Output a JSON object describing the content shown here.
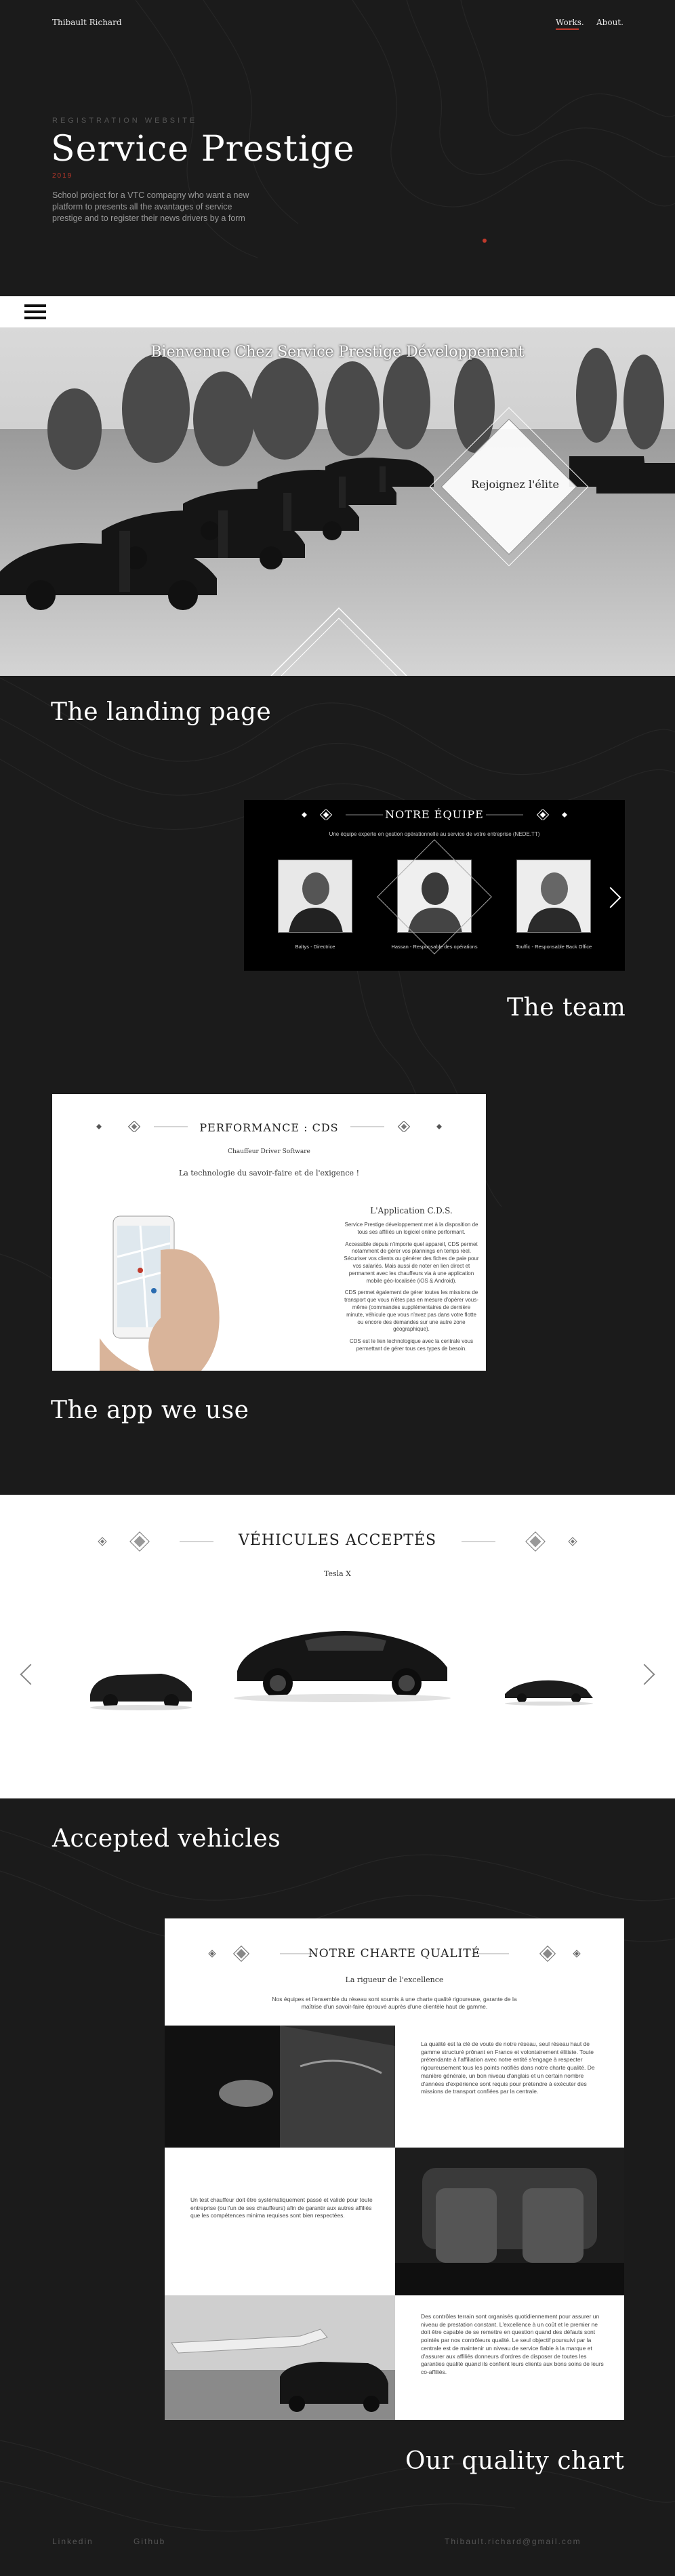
{
  "header": {
    "site_name": "Thibault Richard",
    "nav": {
      "works": "Works.",
      "about": "About."
    }
  },
  "hero": {
    "kicker": "REGISTRATION WEBSITE",
    "title": "Service Prestige",
    "tag": "2019",
    "description": "School project for a VTC compagny who want a new platform to presents all the avantages of service prestige and to register their news drivers by a form"
  },
  "landing": {
    "heading": "Bienvenue Chez Service Prestige Développement",
    "join_label": "Rejoignez l'élite",
    "caption": "The landing page"
  },
  "team": {
    "title": "NOTRE ÉQUIPE",
    "subtitle": "Une équipe experte en gestion opérationnelle au service de votre entreprise (NEDE.TT)",
    "members": [
      {
        "name": "Baltys - Directrice"
      },
      {
        "name": "Hassan - Responsable des opérations"
      },
      {
        "name": "Touffic - Responsable Back Office"
      }
    ],
    "caption": "The team"
  },
  "app": {
    "title": "PERFORMANCE : CDS",
    "subtitle1": "Chauffeur Driver Software",
    "subtitle2": "La technologie du savoir-faire et de l'exigence !",
    "column_title": "L'Application C.D.S.",
    "paragraphs": [
      "Service Prestige développement met à la disposition de tous ses affiliés un logiciel online performant.",
      "Accessible depuis n'importe quel appareil, CDS permet notamment de gérer vos plannings en temps réel. Sécuriser vos clients ou générer des fiches de paie pour vos salariés. Mais aussi de noter en lien direct et permanent avec les chauffeurs via à une application mobile géo-localisée (iOS & Android).",
      "CDS permet également de gérer toutes les missions de transport que vous n'êtes pas en mesure d'opérer vous-même (commandes supplémentaires de dernière minute, véhicule que vous n'avez pas dans votre flotte ou encore des demandes sur une autre zone géographique).",
      "CDS est le lien technologique avec la centrale vous permettant de gérer tous ces types de besoin."
    ],
    "caption": "The app we use"
  },
  "vehicles": {
    "title": "VÉHICULES ACCEPTÉS",
    "current": "Tesla X",
    "caption": "Accepted vehicles"
  },
  "quality": {
    "title": "NOTRE CHARTE QUALITÉ",
    "subtitle": "La rigueur de l'excellence",
    "intro": "Nos équipes et l'ensemble du réseau sont soumis à une charte qualité rigoureuse, garante de la maîtrise d'un savoir-faire éprouvé auprès d'une clientèle haut de gamme.",
    "block1": "La qualité est la clé de voute de notre réseau, seul réseau haut de gamme structuré prônant en France et volontairement élitiste. Toute prétendante à l'affiliation avec notre entité s'engage à respecter rigoureusement tous les points notifiés dans notre charte qualité. De manière générale, un bon niveau d'anglais et un certain nombre d'années d'expérience sont requis pour prétendre à exécuter des missions de transport confiées par la centrale.",
    "block2": "Un test chauffeur doit être systématiquement passé et validé pour toute entreprise (ou l'un de ses chauffeurs) afin de garantir aux autres affiliés que les compétences minima requises sont bien respectées.",
    "block3": "Des contrôles terrain sont organisés quotidiennement pour assurer un niveau de prestation constant. L'excellence à un coût et le premier ne doit être capable de se remettre en question quand des défauts sont pointés par nos contrôleurs qualité. Le seul objectif poursuivi par la centrale est de maintenir un niveau de service fiable à la marque et d'assurer aux affiliés donneurs d'ordres de disposer de toutes les garanties qualité quand ils confient leurs clients aux bons soins de leurs co-affiliés.",
    "caption": "Our quality chart"
  },
  "footer": {
    "linkedin": "Linkedin",
    "github": "Github",
    "email": "Thibault.richard@gmail.com"
  }
}
